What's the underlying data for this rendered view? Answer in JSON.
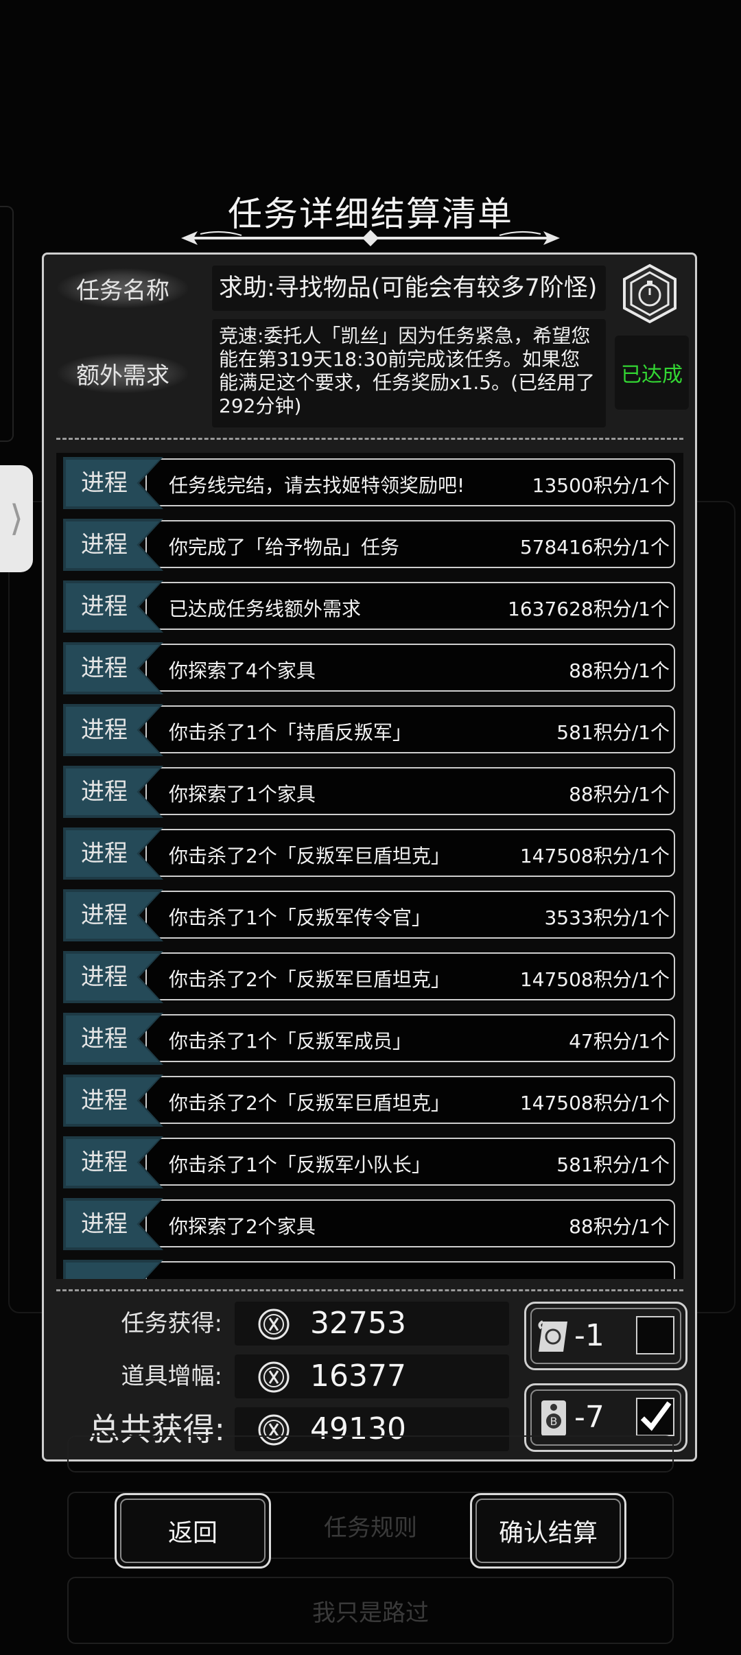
{
  "title": "任务详细结算清单",
  "side_tab_glyph": "⟩",
  "task": {
    "name_label": "任务名称",
    "name_value": "求助:寻找物品(可能会有较多7阶怪)",
    "extra_label": "额外需求",
    "extra_value": "竞速:委托人「凯丝」因为任务紧急，希望您能在第319天18:30前完成该任务。如果您能满足这个要求，任务奖励x1.5。(已经用了292分钟)",
    "extra_status": "已达成",
    "status_color": "#33d633",
    "badge_icon": "stopwatch-badge-icon"
  },
  "progress_rows": [
    {
      "tag": "进程",
      "desc": "任务线完结，请去找姬特领奖励吧!",
      "points": "13500积分/1个"
    },
    {
      "tag": "进程",
      "desc": "你完成了「给予物品」任务",
      "points": "578416积分/1个"
    },
    {
      "tag": "进程",
      "desc": "已达成任务线额外需求",
      "points": "1637628积分/1个"
    },
    {
      "tag": "进程",
      "desc": "你探索了4个家具",
      "points": "88积分/1个"
    },
    {
      "tag": "进程",
      "desc": "你击杀了1个「持盾反叛军」",
      "points": "581积分/1个"
    },
    {
      "tag": "进程",
      "desc": "你探索了1个家具",
      "points": "88积分/1个"
    },
    {
      "tag": "进程",
      "desc": "你击杀了2个「反叛军巨盾坦克」",
      "points": "147508积分/1个"
    },
    {
      "tag": "进程",
      "desc": "你击杀了1个「反叛军传令官」",
      "points": "3533积分/1个"
    },
    {
      "tag": "进程",
      "desc": "你击杀了2个「反叛军巨盾坦克」",
      "points": "147508积分/1个"
    },
    {
      "tag": "进程",
      "desc": "你击杀了1个「反叛军成员」",
      "points": "47积分/1个"
    },
    {
      "tag": "进程",
      "desc": "你击杀了2个「反叛军巨盾坦克」",
      "points": "147508积分/1个"
    },
    {
      "tag": "进程",
      "desc": "你击杀了1个「反叛军小队长」",
      "points": "581积分/1个"
    },
    {
      "tag": "进程",
      "desc": "你探索了2个家具",
      "points": "88积分/1个"
    }
  ],
  "summary": {
    "task_gain_label": "任务获得:",
    "task_gain_value": "32753",
    "item_boost_label": "道具增幅:",
    "item_boost_value": "16377",
    "total_label": "总共获得:",
    "total_value": "49130",
    "coin_icon": "coin-icon"
  },
  "items": [
    {
      "icon": "scroll-icon",
      "count": "-1",
      "checked": false
    },
    {
      "icon": "bitcoin-card-icon",
      "count": "-7",
      "checked": true
    }
  ],
  "buttons": {
    "back": "返回",
    "rules": "任务规则",
    "confirm": "确认结算",
    "pass_by": "我只是路过"
  }
}
